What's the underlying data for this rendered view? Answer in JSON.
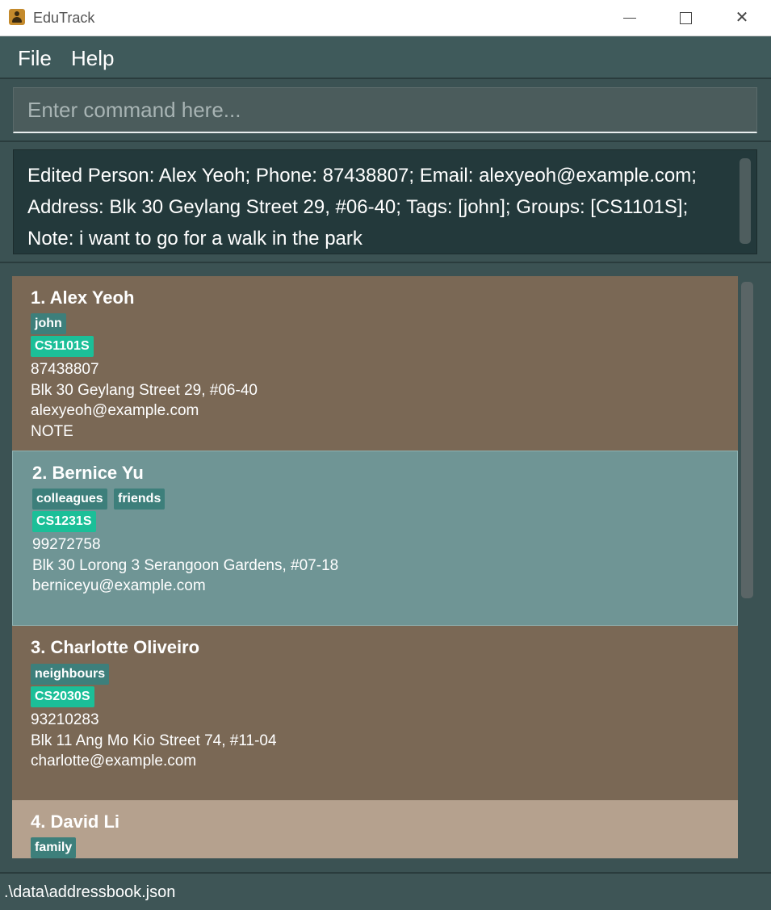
{
  "window": {
    "title": "EduTrack",
    "controls": {
      "minimize": "minimize-icon",
      "maximize": "maximize-icon",
      "close": "close-icon"
    }
  },
  "menu": [
    {
      "label": "File"
    },
    {
      "label": "Help"
    }
  ],
  "command": {
    "value": "",
    "placeholder": "Enter command here..."
  },
  "result": {
    "lines": [
      "Edited Person: Alex Yeoh; Phone: 87438807; Email: alexyeoh@example.com;",
      "Address: Blk 30 Geylang Street 29, #06-40; Tags: [john]; Groups: [CS1101S];",
      "Note: i want to go for a walk in the park"
    ]
  },
  "persons": [
    {
      "name": "1. Alex Yeoh",
      "tags": [
        "john"
      ],
      "group": "CS1101S",
      "phone": "87438807",
      "address": "Blk 30 Geylang Street 29, #06-40",
      "email": "alexyeoh@example.com",
      "note": "NOTE"
    },
    {
      "name": "2. Bernice Yu",
      "tags": [
        "colleagues",
        "friends"
      ],
      "group": "CS1231S",
      "phone": "99272758",
      "address": "Blk 30 Lorong 3 Serangoon Gardens, #07-18",
      "email": "berniceyu@example.com"
    },
    {
      "name": "3. Charlotte Oliveiro",
      "tags": [
        "neighbours"
      ],
      "group": "CS2030S",
      "phone": "93210283",
      "address": "Blk 11 Ang Mo Kio Street 74, #11-04",
      "email": "charlotte@example.com"
    },
    {
      "name": "4. David Li",
      "tags": [
        "family"
      ]
    }
  ],
  "colors": {
    "card_dark": "#7a6855",
    "card_selected": "#6f9595",
    "card_light": "#b5a18e",
    "tag": "#3d7f7b",
    "group": "#1bbf98"
  },
  "status": {
    "path": ".\\data\\addressbook.json"
  }
}
